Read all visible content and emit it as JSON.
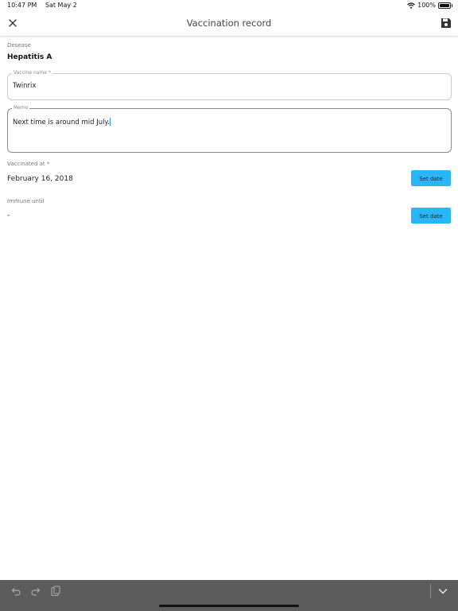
{
  "status_bar": {
    "time": "10:47 PM",
    "date": "Sat May 2",
    "battery": "100%"
  },
  "header": {
    "title": "Vaccination record"
  },
  "disease": {
    "label": "Desease",
    "value": "Hepatitis A"
  },
  "vaccine_name": {
    "label": "Vaccine name *",
    "value": "Twinrix"
  },
  "memo": {
    "label": "Memo",
    "value": "Next time is around mid July."
  },
  "vaccinated_at": {
    "label": "Vaccinated at *",
    "value": "February 16, 2018",
    "button": "Set date"
  },
  "immune_until": {
    "label": "Immune until",
    "value": "-",
    "button": "Set date"
  },
  "icons": {
    "close": "close-icon",
    "save": "save-icon",
    "undo": "undo-icon",
    "redo": "redo-icon",
    "paste": "paste-icon",
    "dismiss": "chevron-down-icon",
    "wifi": "wifi-icon"
  },
  "colors": {
    "accent": "#29b6f6",
    "toolbar": "#5c5c5c",
    "caret": "#3a8fe8"
  }
}
